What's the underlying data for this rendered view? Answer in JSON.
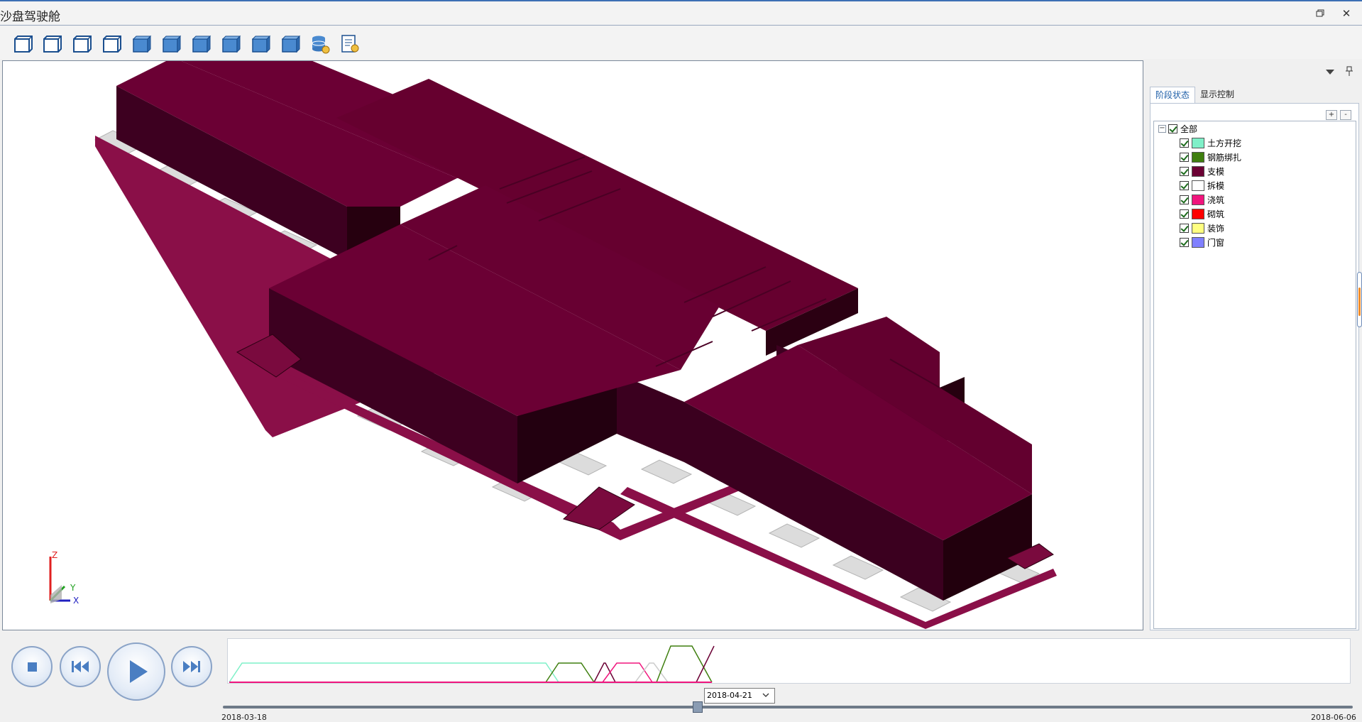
{
  "window": {
    "title": "沙盘驾驶舱"
  },
  "toolbar": {
    "buttons": [
      {
        "icon": "wireframe-view-icon"
      },
      {
        "icon": "wireframe-front-icon"
      },
      {
        "icon": "wireframe-left-icon"
      },
      {
        "icon": "wireframe-right-icon"
      },
      {
        "icon": "shaded-top-icon"
      },
      {
        "icon": "shaded-front-icon"
      },
      {
        "icon": "shaded-back-icon"
      },
      {
        "icon": "shaded-left-icon"
      },
      {
        "icon": "shaded-right-icon"
      },
      {
        "icon": "shaded-bottom-icon"
      },
      {
        "icon": "database-settings-icon"
      },
      {
        "icon": "report-settings-icon"
      }
    ]
  },
  "viewport": {
    "model_color": "#6b0034",
    "axis": {
      "z": "Z",
      "y": "Y",
      "x": "X"
    }
  },
  "panel": {
    "tabs": [
      {
        "label": "阶段状态",
        "active": true
      },
      {
        "label": "显示控制",
        "active": false
      }
    ],
    "expand_all": "+",
    "collapse_all": "-",
    "tree": {
      "root": {
        "label": "全部",
        "expander": "−"
      },
      "items": [
        {
          "label": "土方开挖",
          "color": "#7ff0c8"
        },
        {
          "label": "钢筋绑扎",
          "color": "#3f7f0f"
        },
        {
          "label": "支模",
          "color": "#6b0034"
        },
        {
          "label": "拆模",
          "color": "#ffffff"
        },
        {
          "label": "浇筑",
          "color": "#f0157d"
        },
        {
          "label": "砌筑",
          "color": "#ff0000"
        },
        {
          "label": "装饰",
          "color": "#ffff80"
        },
        {
          "label": "门窗",
          "color": "#8080ff"
        }
      ]
    }
  },
  "player": {
    "stop": "stop-icon",
    "prev": "skip-back-icon",
    "play": "play-icon",
    "next": "skip-forward-icon",
    "current_date": "2018-04-21",
    "start_date": "2018-03-18",
    "end_date": "2018-06-06"
  }
}
